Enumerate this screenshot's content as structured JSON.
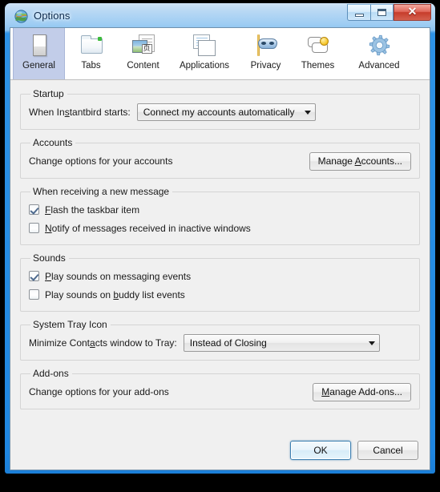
{
  "window": {
    "title": "Options",
    "app_icon": "instantbird-globe-icon",
    "controls": {
      "minimize": "minimize-icon",
      "maximize": "maximize-icon",
      "close": "✕"
    }
  },
  "tabs": [
    {
      "id": "general",
      "label": "General",
      "icon": "general-icon",
      "selected": true
    },
    {
      "id": "tabs",
      "label": "Tabs",
      "icon": "folder-tabs-icon",
      "selected": false
    },
    {
      "id": "content",
      "label": "Content",
      "icon": "content-page-icon",
      "selected": false
    },
    {
      "id": "applications",
      "label": "Applications",
      "icon": "applications-icon",
      "selected": false
    },
    {
      "id": "privacy",
      "label": "Privacy",
      "icon": "privacy-mask-icon",
      "selected": false
    },
    {
      "id": "themes",
      "label": "Themes",
      "icon": "themes-bubble-icon",
      "selected": false
    },
    {
      "id": "advanced",
      "label": "Advanced",
      "icon": "advanced-gear-icon",
      "selected": false
    }
  ],
  "groups": {
    "startup": {
      "legend": "Startup",
      "label_prefix": "When In",
      "label_accel": "s",
      "label_suffix": "tantbird starts:",
      "menulist_value": "Connect my accounts automatically"
    },
    "accounts": {
      "legend": "Accounts",
      "description": "Change options for your accounts",
      "button_prefix": "Manage ",
      "button_accel": "A",
      "button_suffix": "ccounts..."
    },
    "new_message": {
      "legend": "When receiving a new message",
      "items": [
        {
          "accel": "F",
          "rest": "lash the taskbar item",
          "checked": true
        },
        {
          "accel": "N",
          "rest": "otify of messages received in inactive windows",
          "checked": false
        }
      ]
    },
    "sounds": {
      "legend": "Sounds",
      "items": [
        {
          "prefix": "",
          "accel": "P",
          "rest": "lay sounds on messaging events",
          "checked": true
        },
        {
          "prefix": "Play sounds on ",
          "accel": "b",
          "rest": "uddy list events",
          "checked": false
        }
      ]
    },
    "system_tray": {
      "legend": "System Tray Icon",
      "label_prefix": "Minimize Cont",
      "label_accel": "a",
      "label_suffix": "cts window to Tray:",
      "menulist_value": "Instead of Closing"
    },
    "addons": {
      "legend": "Add-ons",
      "description": "Change options for your add-ons",
      "button_prefix": "",
      "button_accel": "M",
      "button_suffix": "anage Add-ons..."
    }
  },
  "buttonbar": {
    "ok": "OK",
    "cancel": "Cancel"
  },
  "colors": {
    "frame_blue": "#1f86e0",
    "selected_tab": "#c2cde9",
    "pane_bg": "#f0f0f0",
    "close_red": "#c63c2b",
    "focus_blue": "#3c7fb1"
  }
}
